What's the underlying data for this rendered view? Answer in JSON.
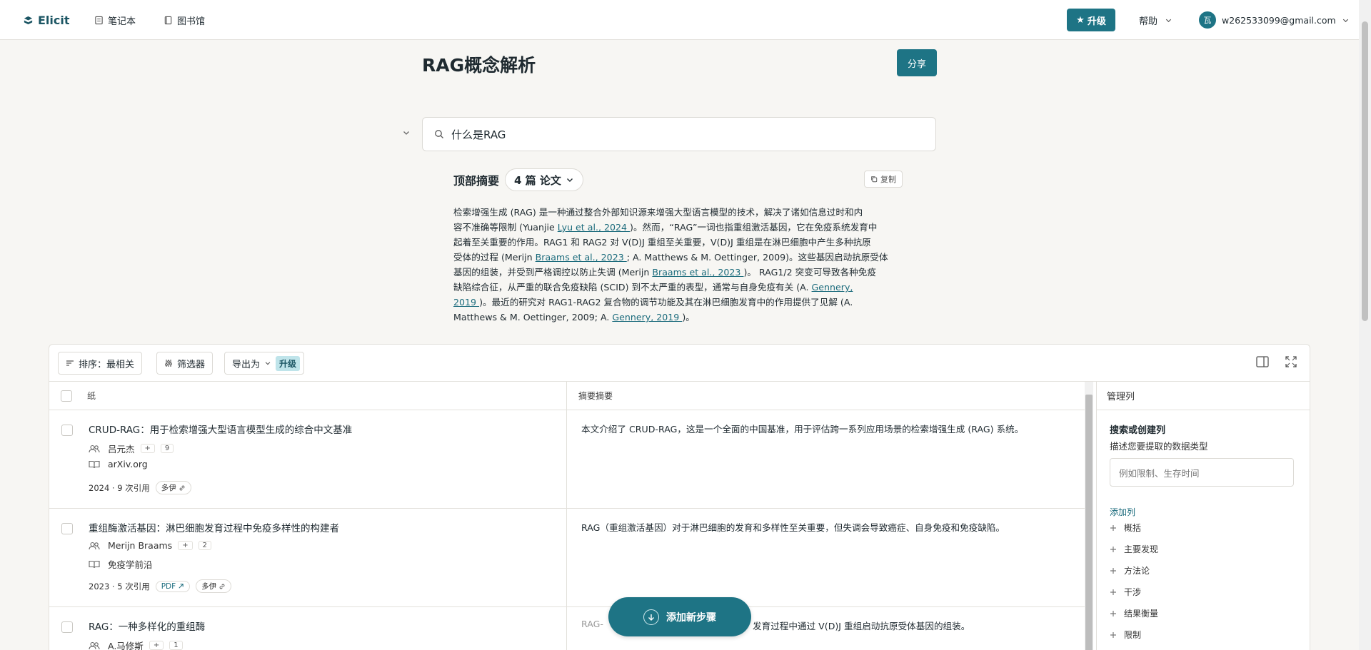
{
  "nav": {
    "logo": "Elicit",
    "notebook": "笔记本",
    "library": "图书馆",
    "upgrade": "升级",
    "help": "帮助",
    "user_initial": "瓦",
    "user_email": "w262533099@gmail.com"
  },
  "header": {
    "title": "RAG概念解析",
    "share": "分享"
  },
  "search": {
    "query": "什么是RAG"
  },
  "summary": {
    "title": "顶部摘要",
    "papers_count": "4 篇 论文",
    "copy": "复制",
    "lines": [
      {
        "parts": [
          {
            "t": "检索增强生成 (RAG) 是一种通过整合外部知识源来增强大型语言模型的技术，解决了诸如信息过时和内"
          }
        ]
      },
      {
        "parts": [
          {
            "t": "容不准确等限制 (Yuanjie "
          },
          {
            "c": "Lyu et al., 2024 "
          },
          {
            "t": ")。然而，“RAG”一词也指重组激活基因，它在免疫系统发育中"
          }
        ]
      },
      {
        "parts": [
          {
            "t": "起着至关重要的作用。RAG1 和 RAG2 对 V(D)J 重组至关重要，V(D)J 重组是在淋巴细胞中产生多种抗原"
          }
        ]
      },
      {
        "parts": [
          {
            "t": "受体的过程 (Merijn "
          },
          {
            "c": "Braams et al., 2023 "
          },
          {
            "t": "; A. Matthews & M. Oettinger, 2009)。这些基因启动抗原受体"
          }
        ]
      },
      {
        "parts": [
          {
            "t": "基因的组装，并受到严格调控以防止失调 (Merijn "
          },
          {
            "c": "Braams et al., 2023 "
          },
          {
            "t": ")。 RAG1/2 突变可导致各种免疫"
          }
        ]
      },
      {
        "parts": [
          {
            "t": "缺陷综合征，从严重的联合免疫缺陷 (SCID) 到不太严重的表型，通常与自身免疫有关 (A. "
          },
          {
            "c": "Gennery,"
          }
        ]
      },
      {
        "parts": [
          {
            "c": "2019 "
          },
          {
            "t": ")。最近的研究对 RAG1-RAG2 复合物的调节功能及其在淋巴细胞发育中的作用提供了见解 (A."
          }
        ]
      },
      {
        "parts": [
          {
            "t": "Matthews & M. Oettinger, 2009; A. "
          },
          {
            "c": "Gennery, 2019 "
          },
          {
            "t": ")。"
          }
        ]
      }
    ]
  },
  "toolbar": {
    "sort": "排序：最相关",
    "filter": "筛选器",
    "export": "导出为",
    "upgrade_tag": "升级"
  },
  "table": {
    "col_paper": "纸",
    "col_summary": "摘要摘要",
    "rows": [
      {
        "title": "CRUD-RAG：用于检索增强大型语言模型生成的综合中文基准",
        "author": "吕元杰",
        "plus": "+",
        "more_authors": "9",
        "venue": "arXiv.org",
        "stats": "2024 · 9 次引用",
        "pdf": "",
        "chip": "多伊",
        "summary": "本文介绍了 CRUD-RAG，这是一个全面的中国基准，用于评估跨一系列应用场景的检索增强生成 (RAG) 系统。"
      },
      {
        "title": "重组酶激活基因：淋巴细胞发育过程中免疫多样性的构建者",
        "author": "Merijn Braams",
        "plus": "+",
        "more_authors": "2",
        "venue": "免疫学前沿",
        "stats": "2023 · 5 次引用",
        "pdf": "PDF",
        "chip": "多伊",
        "summary": "RAG（重组激活基因）对于淋巴细胞的发育和多样性至关重要，但失调会导致癌症、自身免疫和免疫缺陷。"
      },
      {
        "title": "RAG：一种多样化的重组酶",
        "author": "A.马修斯",
        "plus": "+",
        "more_authors": "1",
        "summary_visible": "RAG-",
        "summary_tail": "发育过程中通过 V(D)J 重组启动抗原受体基因的组装。"
      }
    ]
  },
  "side_panel": {
    "header": "管理列",
    "title": "搜索或创建列",
    "desc": "描述您要提取的数据类型",
    "placeholder": "例如限制、生存时间",
    "add_label": "添加列",
    "options": [
      "概括",
      "主要发现",
      "方法论",
      "干涉",
      "结果衡量",
      "限制"
    ]
  },
  "fab": {
    "label": "添加新步骤"
  },
  "colors": {
    "accent": "#1e7485",
    "background": "#f7f6f3",
    "link": "#1b6b7c"
  }
}
